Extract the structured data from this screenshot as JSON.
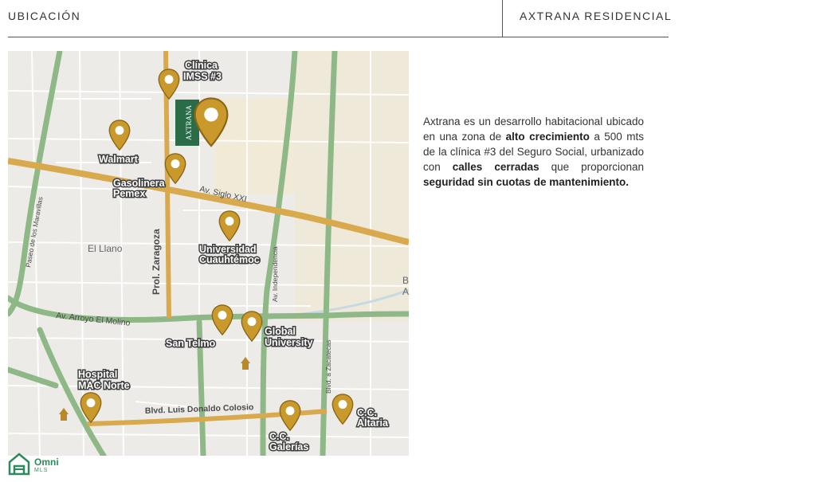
{
  "header": {
    "section_title": "UBICACIÓN",
    "project_name": "AXTRANA RESIDENCIAL"
  },
  "map": {
    "development_label": "AXTRANA",
    "places": {
      "clinica": [
        "Clínica",
        "IMSS #3"
      ],
      "walmart": [
        "Walmart"
      ],
      "gasolinera": [
        "Gasolinera",
        "Pemex"
      ],
      "universidad": [
        "Universidad",
        "Cuauhtémoc"
      ],
      "san_telmo": [
        "San Telmo"
      ],
      "global": [
        "Global",
        "University"
      ],
      "hospital": [
        "Hospital",
        "MAC Norte"
      ],
      "galerias": [
        "C.C.",
        "Galerías"
      ],
      "altaria": [
        "C.C.",
        "Altaria"
      ]
    },
    "streets": {
      "siglo": "Av. Siglo XXI",
      "zaragoza": "Prol. Zaragoza",
      "arroyo": "Av. Arroyo El Molino",
      "colosio": "Blvd. Luis Donaldo Colosio",
      "independencia": "Av. Independencia",
      "zacatecas": "Blvd. a Zacatecas",
      "paseo": "Paseo de los Maravillas"
    },
    "area": "El Llano",
    "edge_letters": [
      "B",
      "A"
    ]
  },
  "description": {
    "parts": [
      "Axtrana es un desarrollo habitacional ubicado en una zona de ",
      "alto crecimiento",
      " a 500 mts de la clínica #3 del Seguro Social, urbanizado con ",
      "calles cerradas",
      " que proporcionan ",
      "seguridad sin cuotas de mantenimiento."
    ]
  },
  "logo": {
    "name": "Omni",
    "sub": "MLS"
  },
  "colors": {
    "main_road": "#d9a94e",
    "green_road": "#8fb887",
    "pin": "#c99a2b",
    "brand_green": "#2d8a5c"
  }
}
